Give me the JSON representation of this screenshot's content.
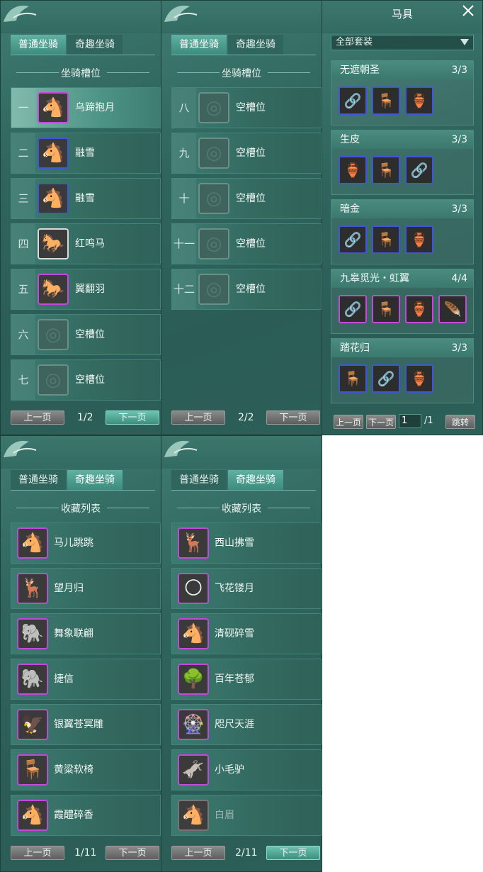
{
  "panels": {
    "normal_1": {
      "tabs": [
        "普通坐骑",
        "奇趣坐骑"
      ],
      "section_title": "坐骑槽位",
      "rows": [
        {
          "num": "一",
          "label": "乌蹄抱月"
        },
        {
          "num": "二",
          "label": "融雪"
        },
        {
          "num": "三",
          "label": "融雪"
        },
        {
          "num": "四",
          "label": "红鸣马"
        },
        {
          "num": "五",
          "label": "翼翻羽"
        },
        {
          "num": "六",
          "label": "空槽位"
        },
        {
          "num": "七",
          "label": "空槽位"
        }
      ],
      "prev_label": "上一页",
      "next_label": "下一页",
      "page": "1/2"
    },
    "normal_2": {
      "tabs": [
        "普通坐骑",
        "奇趣坐骑"
      ],
      "section_title": "坐骑槽位",
      "rows": [
        {
          "num": "八",
          "label": "空槽位"
        },
        {
          "num": "九",
          "label": "空槽位"
        },
        {
          "num": "十",
          "label": "空槽位"
        },
        {
          "num": "十一",
          "label": "空槽位"
        },
        {
          "num": "十二",
          "label": "空槽位"
        }
      ],
      "prev_label": "上一页",
      "next_label": "下一页",
      "page": "2/2"
    },
    "fun_1": {
      "tabs": [
        "普通坐骑",
        "奇趣坐骑"
      ],
      "section_title": "收藏列表",
      "rows": [
        {
          "label": "马儿跳跳"
        },
        {
          "label": "望月归"
        },
        {
          "label": "舞象联翩"
        },
        {
          "label": "捷信"
        },
        {
          "label": "银翼苍冥雕"
        },
        {
          "label": "黄粱软椅"
        },
        {
          "label": "霞醴碎香"
        }
      ],
      "prev_label": "上一页",
      "next_label": "下一页",
      "page": "1/11"
    },
    "fun_2": {
      "tabs": [
        "普通坐骑",
        "奇趣坐骑"
      ],
      "section_title": "收藏列表",
      "rows": [
        {
          "label": "西山拂雪"
        },
        {
          "label": "飞花镂月"
        },
        {
          "label": "清砚碎雪"
        },
        {
          "label": "百年苍郁"
        },
        {
          "label": "咫尺天涯"
        },
        {
          "label": "小毛驴"
        },
        {
          "label": "白眉"
        }
      ],
      "prev_label": "上一页",
      "next_label": "下一页",
      "page": "2/11"
    }
  },
  "saddle": {
    "title": "马具",
    "filter": "全部套装",
    "sets": [
      {
        "name": "无遮朝圣",
        "count": "3/3"
      },
      {
        "name": "生皮",
        "count": "3/3"
      },
      {
        "name": "暗金",
        "count": "3/3"
      },
      {
        "name": "九皋觅光・虹翼",
        "count": "4/4"
      },
      {
        "name": "踏花归",
        "count": "3/3"
      }
    ],
    "prev_label": "上一页",
    "next_label": "下一页",
    "page_input": "1",
    "page_total": "/1",
    "jump_label": "跳转"
  }
}
